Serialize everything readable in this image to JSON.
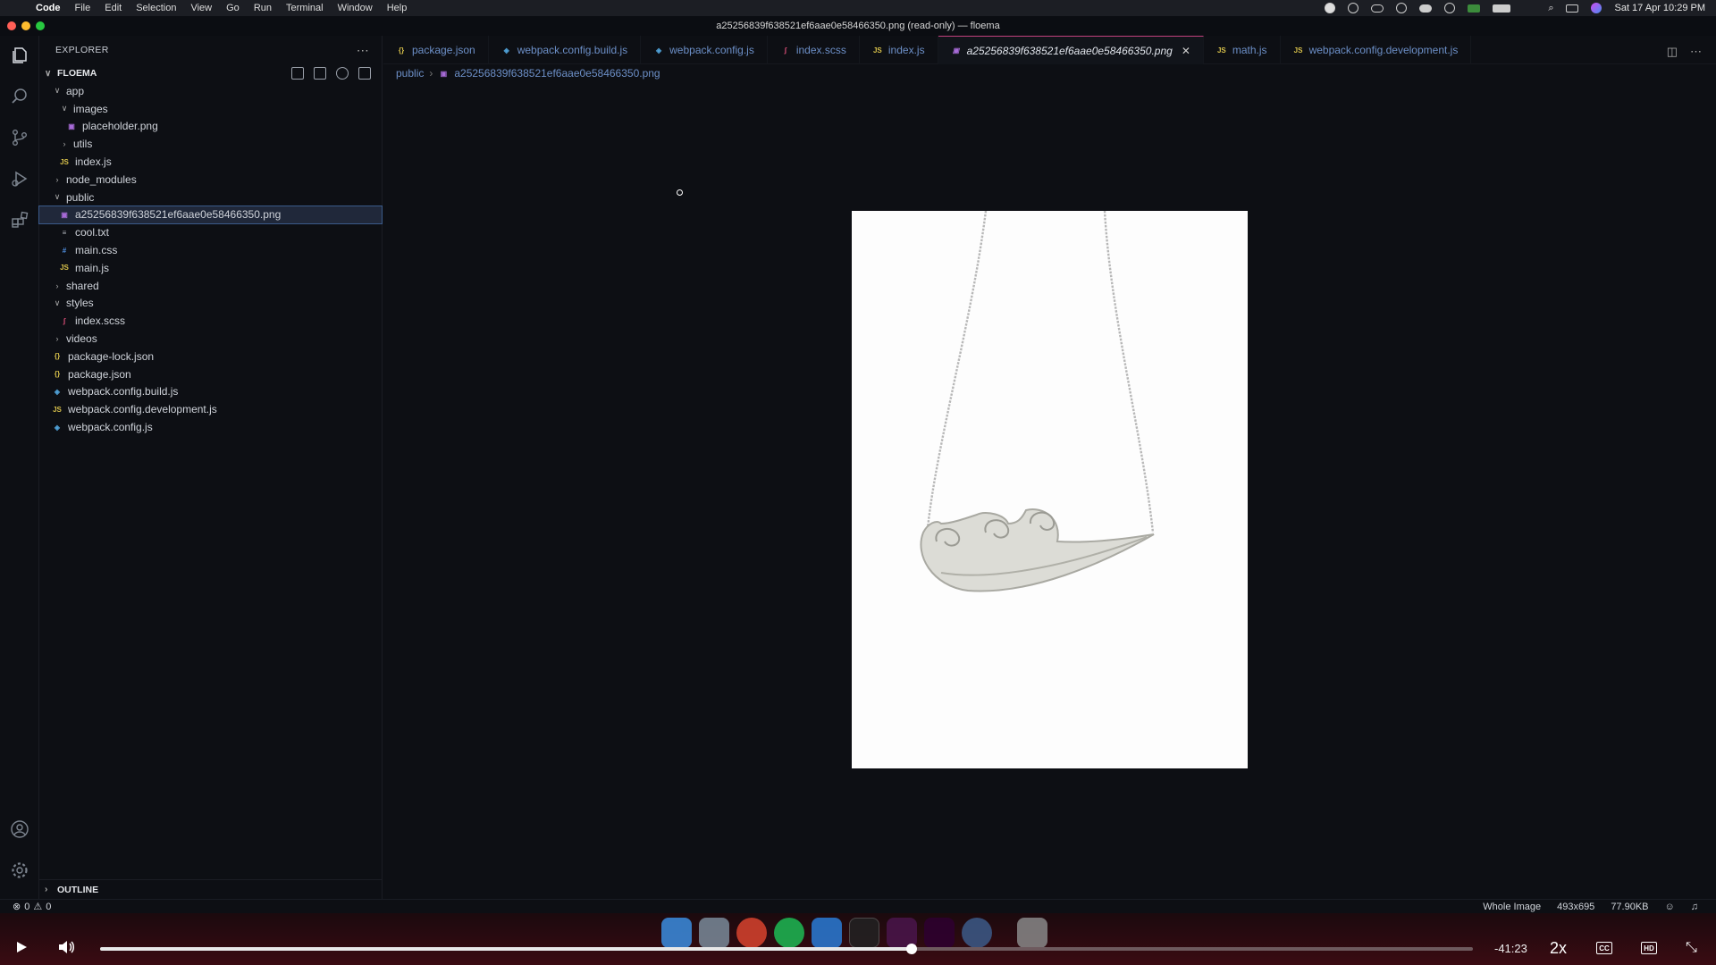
{
  "menubar": {
    "app": "Code",
    "items": [
      "File",
      "Edit",
      "Selection",
      "View",
      "Go",
      "Run",
      "Terminal",
      "Window",
      "Help"
    ],
    "clock": "Sat 17 Apr  10:29 PM"
  },
  "window": {
    "title": "a25256839f638521ef6aae0e58466350.png (read-only) — floema"
  },
  "sidebar": {
    "header": "EXPLORER",
    "project": "FLOEMA",
    "tree": [
      {
        "label": "app",
        "depth": 0,
        "kind": "folder-open"
      },
      {
        "label": "images",
        "depth": 1,
        "kind": "folder-open"
      },
      {
        "label": "placeholder.png",
        "depth": 2,
        "kind": "png"
      },
      {
        "label": "utils",
        "depth": 1,
        "kind": "folder"
      },
      {
        "label": "index.js",
        "depth": 1,
        "kind": "js"
      },
      {
        "label": "node_modules",
        "depth": 0,
        "kind": "folder"
      },
      {
        "label": "public",
        "depth": 0,
        "kind": "folder-open"
      },
      {
        "label": "a25256839f638521ef6aae0e58466350.png",
        "depth": 1,
        "kind": "png",
        "selected": true
      },
      {
        "label": "cool.txt",
        "depth": 1,
        "kind": "txt"
      },
      {
        "label": "main.css",
        "depth": 1,
        "kind": "css"
      },
      {
        "label": "main.js",
        "depth": 1,
        "kind": "js"
      },
      {
        "label": "shared",
        "depth": 0,
        "kind": "folder"
      },
      {
        "label": "styles",
        "depth": 0,
        "kind": "folder-open"
      },
      {
        "label": "index.scss",
        "depth": 1,
        "kind": "scss"
      },
      {
        "label": "videos",
        "depth": 0,
        "kind": "folder"
      },
      {
        "label": "package-lock.json",
        "depth": 0,
        "kind": "json"
      },
      {
        "label": "package.json",
        "depth": 0,
        "kind": "json"
      },
      {
        "label": "webpack.config.build.js",
        "depth": 0,
        "kind": "webpack"
      },
      {
        "label": "webpack.config.development.js",
        "depth": 0,
        "kind": "js"
      },
      {
        "label": "webpack.config.js",
        "depth": 0,
        "kind": "webpack"
      }
    ],
    "outline": "OUTLINE"
  },
  "tabs": [
    {
      "label": "package.json",
      "kind": "json"
    },
    {
      "label": "webpack.config.build.js",
      "kind": "webpack"
    },
    {
      "label": "webpack.config.js",
      "kind": "webpack"
    },
    {
      "label": "index.scss",
      "kind": "scss"
    },
    {
      "label": "index.js",
      "kind": "js"
    },
    {
      "label": "a25256839f638521ef6aae0e58466350.png",
      "kind": "png",
      "active": true
    },
    {
      "label": "math.js",
      "kind": "js"
    },
    {
      "label": "webpack.config.development.js",
      "kind": "js"
    }
  ],
  "breadcrumb": {
    "folder": "public",
    "file": "a25256839f638521ef6aae0e58466350.png"
  },
  "statusbar": {
    "errors": "0",
    "warnings": "0",
    "zoom_mode": "Whole Image",
    "dimensions": "493x695",
    "size": "77.90KB"
  },
  "player": {
    "time": "-41:23",
    "speed": "2x",
    "progress": 0.591
  },
  "colors": {
    "accent_tab": "#c2407d",
    "tab_text": "#6c8fc7",
    "js_icon": "#d7c04a",
    "png_icon": "#a66ad6",
    "webpack_icon": "#4fa0d6",
    "scss_icon": "#e0507a"
  }
}
